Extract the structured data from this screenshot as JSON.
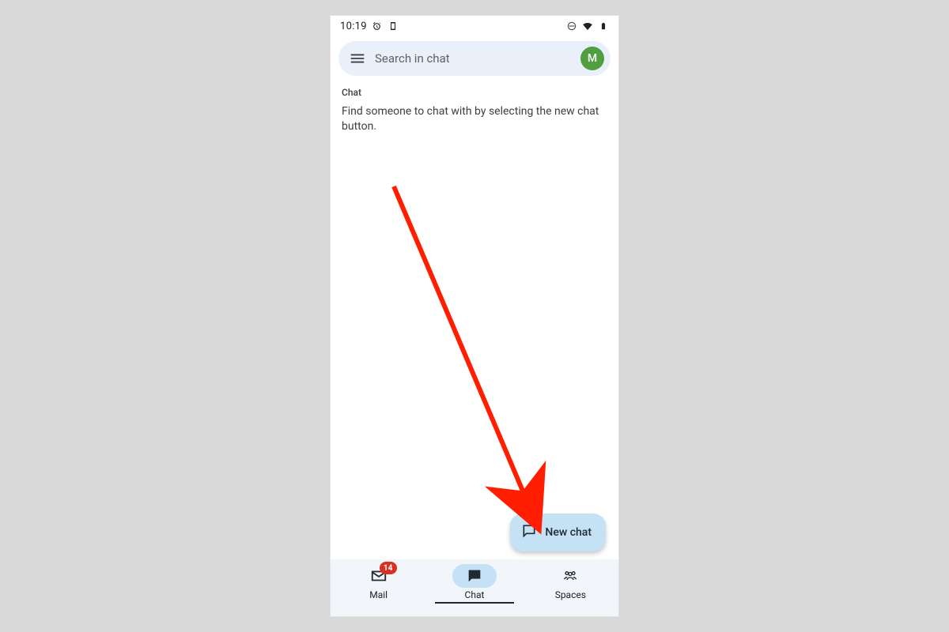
{
  "statusbar": {
    "time": "10:19"
  },
  "search": {
    "placeholder": "Search in chat",
    "avatar_initial": "M"
  },
  "section": {
    "label": "Chat",
    "empty_text": "Find someone to chat with by selecting the new chat button."
  },
  "fab": {
    "label": "New chat"
  },
  "bottomnav": {
    "mail": {
      "label": "Mail",
      "badge": "14"
    },
    "chat": {
      "label": "Chat"
    },
    "spaces": {
      "label": "Spaces"
    }
  },
  "colors": {
    "accent_pill": "#c4e1f6",
    "avatar": "#4f9e3f",
    "badge": "#d93025",
    "annotation": "#ff1e00"
  }
}
